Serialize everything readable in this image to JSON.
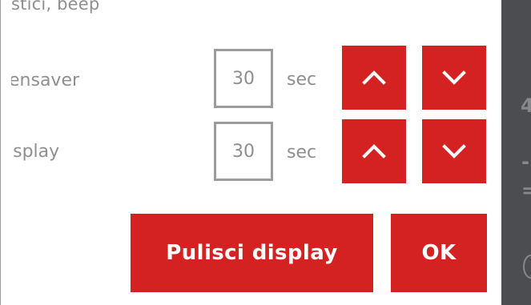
{
  "dialog": {
    "cutoff_text": "stici, beep",
    "rows": [
      {
        "label": "ensaver",
        "value": "30",
        "unit": "sec"
      },
      {
        "label": "isplay",
        "value": "30",
        "unit": "sec"
      }
    ],
    "buttons": {
      "clean_label": "Pulisci display",
      "ok_label": "OK"
    }
  },
  "background_strip": {
    "glyphs": [
      "4",
      "-",
      "="
    ]
  },
  "colors": {
    "accent": "#d42222",
    "text": "#8f8f8f",
    "strip": "#4b4d50"
  },
  "icons": {
    "up": "chevron-up-icon",
    "down": "chevron-down-icon"
  }
}
